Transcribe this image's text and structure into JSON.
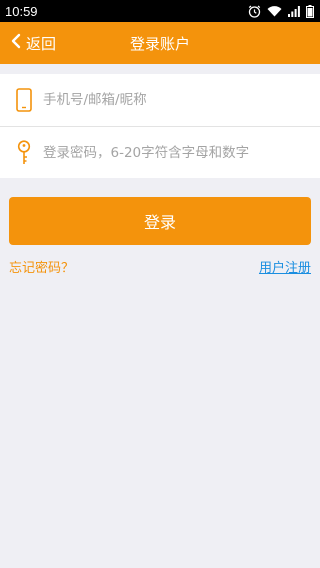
{
  "status_bar": {
    "time": "10:59",
    "icons": [
      "alarm-icon",
      "wifi-icon",
      "signal-icon",
      "battery-icon"
    ]
  },
  "header": {
    "back_label": "返回",
    "title": "登录账户"
  },
  "form": {
    "account_placeholder": "手机号/邮箱/昵称",
    "password_placeholder": "登录密码，6-20字符含字母和数字"
  },
  "login_button_label": "登录",
  "forgot_password_label": "忘记密码？",
  "register_label": "用户注册",
  "colors": {
    "accent": "#f4930c",
    "link": "#1a8ee0",
    "background": "#efeff4"
  }
}
